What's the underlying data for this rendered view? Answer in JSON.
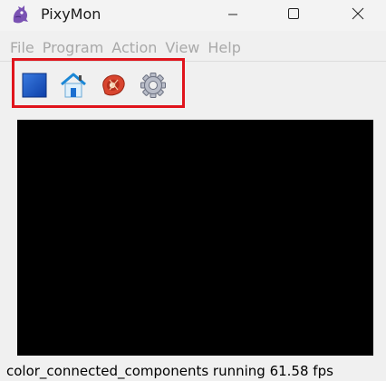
{
  "window": {
    "title": "PixyMon",
    "icon": "pixymon-logo-icon",
    "controls": [
      "minimize-icon",
      "maximize-icon",
      "close-icon"
    ]
  },
  "menu": {
    "items": [
      {
        "label": "File"
      },
      {
        "label": "Program"
      },
      {
        "label": "Action"
      },
      {
        "label": "View"
      },
      {
        "label": "Help"
      }
    ]
  },
  "toolbar": {
    "highlight_color": "#e0141c",
    "buttons": [
      {
        "icon": "blue-square-icon"
      },
      {
        "icon": "home-icon"
      },
      {
        "icon": "steak-icon"
      },
      {
        "icon": "gear-icon"
      }
    ]
  },
  "video": {
    "background": "#000000"
  },
  "status": {
    "text": "color_connected_components running 61.58 fps"
  }
}
